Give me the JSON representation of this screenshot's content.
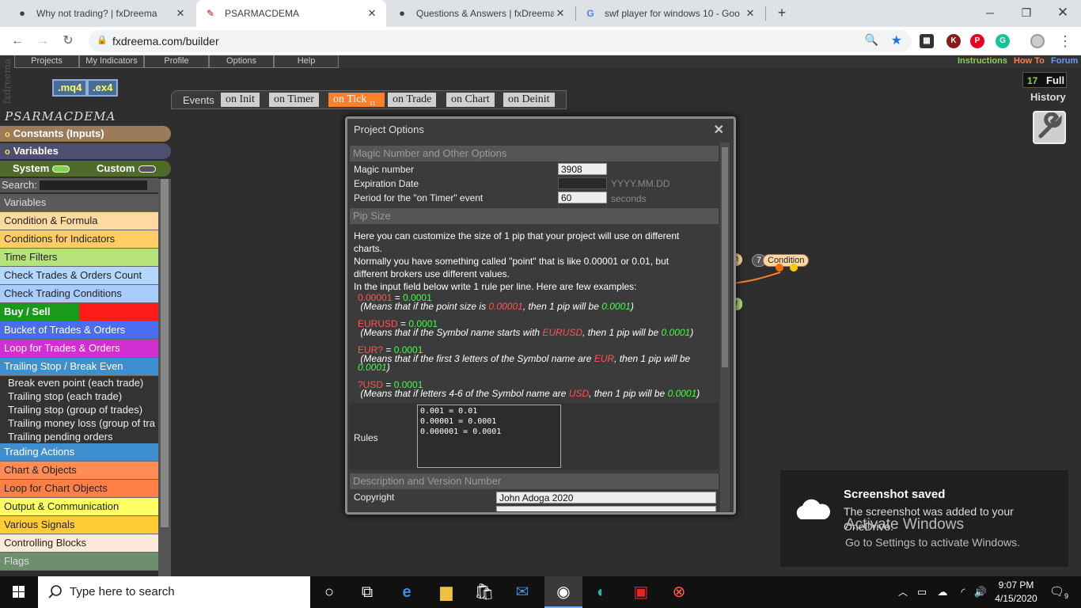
{
  "browser": {
    "tabs": [
      {
        "title": "Why not trading? | fxDreema"
      },
      {
        "title": "PSARMACDEMA"
      },
      {
        "title": "Questions & Answers | fxDreema"
      },
      {
        "title": "swf player for windows 10 - Goo"
      }
    ],
    "url": "fxdreema.com/builder",
    "ext_k": "K"
  },
  "app": {
    "brand": "fxdreema",
    "menu": [
      "Projects",
      "My Indicators",
      "Profile",
      "Options",
      "Help"
    ],
    "links": {
      "instructions": "Instructions",
      "howto": "How To",
      "forum": "Forum"
    },
    "mq4": ".mq4",
    "ex4": ".ex4",
    "events_label": "Events",
    "events": [
      "on Init",
      "on Timer",
      "on Tick",
      "on Trade",
      "on Chart",
      "on Deinit"
    ],
    "tick_badge": "11",
    "count": "17",
    "full_label": "Full",
    "history_label": "History",
    "project_name": "PSARMACDEMA",
    "constants_label": "Constants (Inputs)",
    "variables_label": "Variables",
    "bullet": "o",
    "system_label": "System",
    "custom_label": "Custom",
    "search_label": "Search:",
    "categories": [
      {
        "label": "Variables",
        "bg": "#5a5a5a",
        "color": "#dddddd"
      },
      {
        "label": "Condition & Formula",
        "bg": "#ffd9a0",
        "color": "#222222"
      },
      {
        "label": "Conditions for Indicators",
        "bg": "#ffcc66",
        "color": "#222222"
      },
      {
        "label": "Time Filters",
        "bg": "#b5e27a",
        "color": "#222222"
      },
      {
        "label": "Check Trades & Orders Count",
        "bg": "#b3d7ff",
        "color": "#222222"
      },
      {
        "label": "Check Trading Conditions",
        "bg": "#a9ccff",
        "color": "#222222"
      }
    ],
    "buysell": "Buy / Sell",
    "categories2": [
      {
        "label": "Bucket of Trades & Orders",
        "bg": "#4a6cf0",
        "color": "#ffffff"
      },
      {
        "label": "Loop for Trades & Orders",
        "bg": "#d22fd2",
        "color": "#ffffff"
      },
      {
        "label": "Trailing Stop / Break Even",
        "bg": "#3e8fcf",
        "color": "#ffffff"
      }
    ],
    "subitems": [
      "Break even point (each trade)",
      "Trailing stop (each trade)",
      "Trailing stop (group of trades)",
      "Trailing money loss (group of tra",
      "Trailing pending orders"
    ],
    "categories3": [
      {
        "label": "Trading Actions",
        "bg": "#3e8fcf",
        "color": "#ffffff"
      },
      {
        "label": "Chart & Objects",
        "bg": "#ff8c55",
        "color": "#222222"
      },
      {
        "label": "Loop for Chart Objects",
        "bg": "#ff7f45",
        "color": "#222222"
      },
      {
        "label": "Output & Communication",
        "bg": "#ffff66",
        "color": "#222222"
      },
      {
        "label": "Various Signals",
        "bg": "#ffcc33",
        "color": "#222222"
      },
      {
        "label": "Controlling Blocks",
        "bg": "#ffe9d9",
        "color": "#222222"
      },
      {
        "label": "Flags",
        "bg": "#6e8f6e",
        "color": "#dddddd"
      }
    ],
    "nodes": {
      "a": "n",
      "b_num": "7",
      "b_label": "Condition",
      "c": "r"
    }
  },
  "modal": {
    "title": "Project Options",
    "sec1": "Magic Number and Other Options",
    "magic_label": "Magic number",
    "magic_value": "3908",
    "exp_label": "Expiration Date",
    "exp_hint": "YYYY.MM.DD",
    "timer_label": "Period for the \"on Timer\" event",
    "timer_value": "60",
    "timer_hint": "seconds",
    "sec2": "Pip Size",
    "pip_desc": "Here you can customize the size of 1 pip that your project will use on different charts.\nNormally you have something called \"point\" that is like 0.00001 or 0.01, but different brokers use different values.\nIn the input field below write 1 rule per line. Here are few examples:",
    "ex1": {
      "key": "0.00001",
      "val": "0.0001",
      "p1": "(Means that if the point size is ",
      "k2": "0.00001",
      "p2": ", then 1 pip will be ",
      "v2": "0.0001",
      "p3": ")"
    },
    "ex2": {
      "key": "EURUSD",
      "val": "0.0001",
      "p1": "(Means that if the Symbol name starts with ",
      "k2": "EURUSD",
      "p2": ", then 1 pip will be ",
      "v2": "0.0001",
      "p3": ")"
    },
    "ex3": {
      "key": "EUR?",
      "val": "0.0001",
      "p1": "(Means that if the first 3 letters of the Symbol name are ",
      "k2": "EUR",
      "p2": ", then 1 pip will be ",
      "v2": "0.0001",
      "p3": ")"
    },
    "ex4": {
      "key": "?USD",
      "val": "0.0001",
      "p1": "(Means that if letters 4-6 of the Symbol name are ",
      "k2": "USD",
      "p2": ", then 1 pip will be ",
      "v2": "0.0001",
      "p3": ")"
    },
    "rules_label": "Rules",
    "rules": [
      "0.001 = 0.01",
      "0.00001 = 0.0001",
      "0.000001 = 0.0001"
    ],
    "sec3": "Description and Version Number",
    "copyright_label": "Copyright",
    "copyright_value": "John Adoga 2020"
  },
  "toast": {
    "title": "Screenshot saved",
    "body": "The screenshot was added to your",
    "body2": "OneDrive.",
    "watermark1": "Activate Windows",
    "watermark2": "Go to Settings to activate Windows."
  },
  "taskbar": {
    "search_placeholder": "Type here to search",
    "time": "9:07 PM",
    "date": "4/15/2020",
    "notif_count": "9"
  }
}
